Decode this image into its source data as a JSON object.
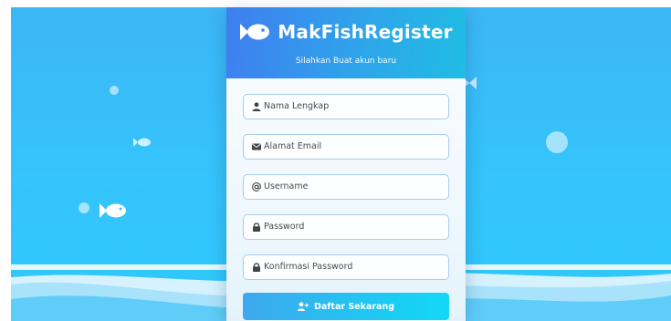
{
  "brand": {
    "title": "MakFishRegister",
    "icon": "fish-icon"
  },
  "header": {
    "subtitle": "Silahkan Buat akun baru"
  },
  "form": {
    "fields": [
      {
        "name": "full-name",
        "icon": "user-icon",
        "placeholder": "Nama Lengkap"
      },
      {
        "name": "email",
        "icon": "envelope-icon",
        "placeholder": "Alamat Email"
      },
      {
        "name": "username",
        "icon": "at-icon",
        "placeholder": "Username"
      },
      {
        "name": "password",
        "icon": "lock-icon",
        "placeholder": "Password"
      },
      {
        "name": "confirm-password",
        "icon": "lock-icon",
        "placeholder": "Konfirmasi Password"
      }
    ],
    "submit_label": "Daftar Sekarang",
    "submit_icon": "user-plus-icon"
  },
  "colors": {
    "header_start": "#3f7ef0",
    "header_end": "#1fbde3",
    "background": "#35c4fb",
    "field_border": "#a9cdf0"
  }
}
